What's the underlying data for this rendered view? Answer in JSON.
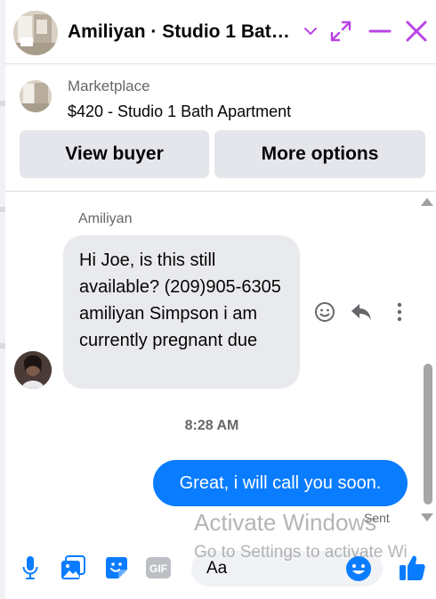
{
  "header": {
    "title": "Amiliyan · Studio 1 Bat…"
  },
  "marketplace": {
    "label": "Marketplace",
    "listing": "$420 - Studio 1 Bath Apartment"
  },
  "actions": {
    "view_buyer": "View buyer",
    "more_options": "More options"
  },
  "conversation": {
    "sender_name": "Amiliyan",
    "incoming_message": "Hi Joe, is this still available? (209)905-6305 amiliyan Simpson i am currently pregnant due",
    "timestamp": "8:28 AM",
    "outgoing_message": "Great, i will call you soon.",
    "status": "Sent"
  },
  "composer": {
    "placeholder": "Aa"
  },
  "watermark": {
    "line1": "Activate Windows",
    "line2": "Go to Settings to activate Wi"
  },
  "colors": {
    "accent": "#0a7cff",
    "header_icons": "#b844e5",
    "incoming_bubble": "#e9eaed",
    "button_bg": "#e4e6eb"
  },
  "icons": {
    "header": [
      "chevron-down-icon",
      "expand-icon",
      "minimize-icon",
      "close-icon"
    ],
    "message_actions": [
      "smiley-icon",
      "reply-icon",
      "more-icon"
    ],
    "composer_tools": [
      "microphone-icon",
      "photo-icon",
      "sticker-icon",
      "gif-icon",
      "emoji-icon",
      "thumbs-up-icon"
    ]
  }
}
